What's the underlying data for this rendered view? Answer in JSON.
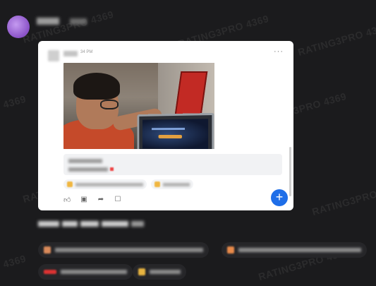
{
  "watermark": {
    "text": "RATING3PRO 4369",
    "short": "4369"
  },
  "message": {
    "sender_name": "████",
    "timestamp": "██ ██"
  },
  "card": {
    "author": "███",
    "time": "34 PM",
    "more": "···",
    "fab_label": "+",
    "actions": [
      "like",
      "comment",
      "share",
      "bookmark"
    ]
  },
  "colors": {
    "background": "#1b1b1d",
    "accent_blue": "#1e6ee8",
    "avatar_purple": "#9b66d8"
  }
}
